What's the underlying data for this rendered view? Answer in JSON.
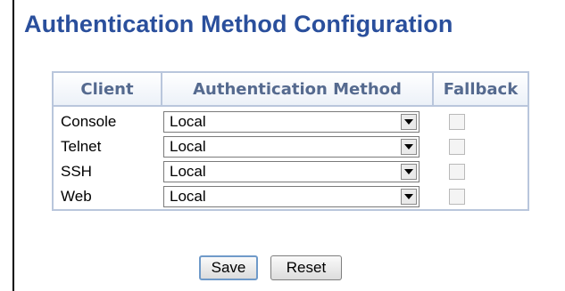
{
  "title": "Authentication Method Configuration",
  "table": {
    "headers": {
      "client": "Client",
      "method": "Authentication Method",
      "fallback": "Fallback"
    },
    "rows": [
      {
        "client": "Console",
        "method": "Local",
        "fallback": false
      },
      {
        "client": "Telnet",
        "method": "Local",
        "fallback": false
      },
      {
        "client": "SSH",
        "method": "Local",
        "fallback": false
      },
      {
        "client": "Web",
        "method": "Local",
        "fallback": false
      }
    ]
  },
  "buttons": {
    "save": "Save",
    "reset": "Reset"
  },
  "colors": {
    "title": "#2a4f9c",
    "header_text": "#556a8f",
    "table_border": "#b9c6dc"
  }
}
